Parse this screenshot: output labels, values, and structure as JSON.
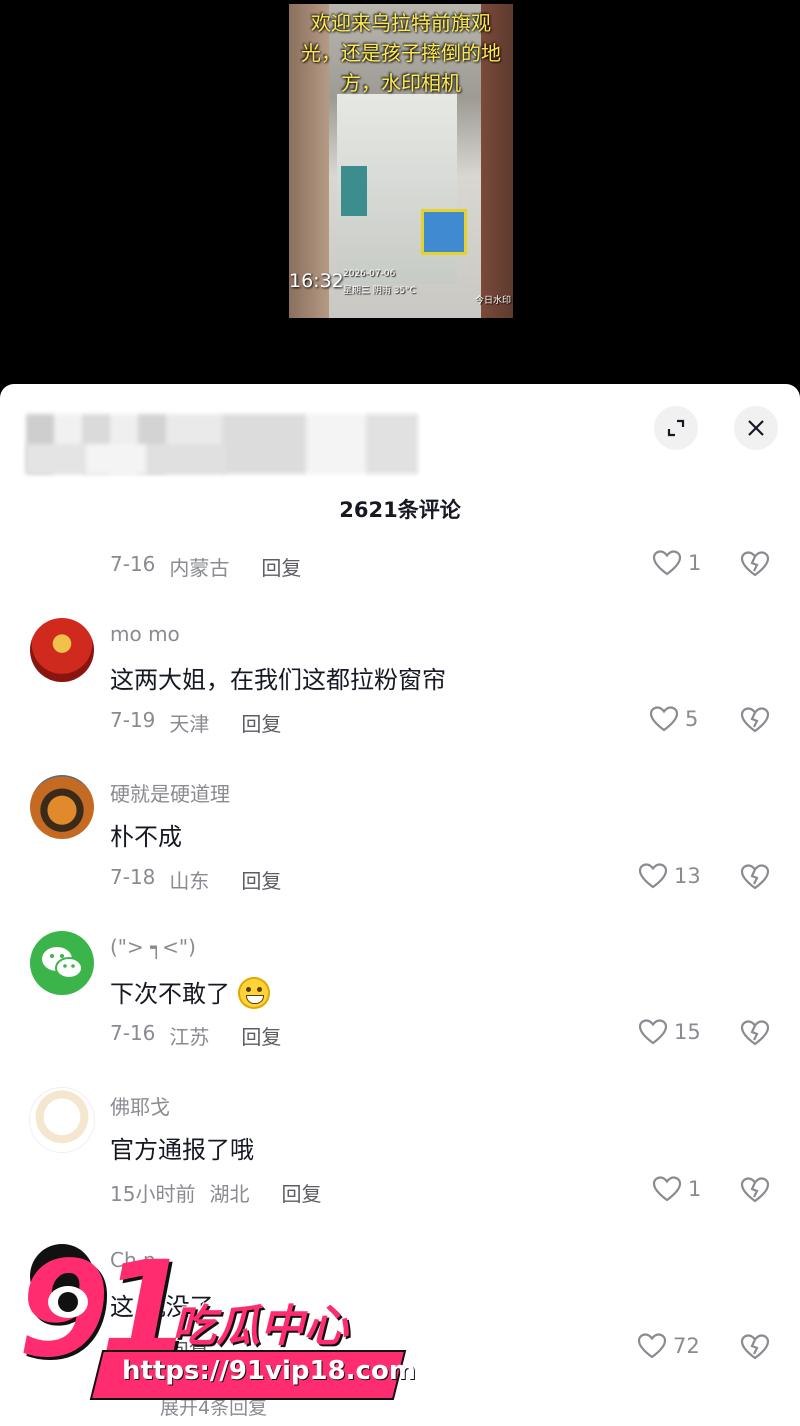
{
  "video": {
    "caption": "欢迎来乌拉特前旗观光，还是孩子摔倒的地方，水印相机",
    "time": "16:32",
    "date": "2026-07-06",
    "meta": "星期三 阴雨 35°C",
    "watermark": "今日水印"
  },
  "sheet": {
    "comment_count": "2621条评论",
    "expand_icon": "expand-icon",
    "close_icon": "close-icon"
  },
  "comments": [
    {
      "name": "",
      "text": "",
      "date": "7-16",
      "location": "内蒙古",
      "reply": "回复",
      "likes": "1"
    },
    {
      "name": "mo  mo",
      "text": "这两大姐，在我们这都拉粉窗帘",
      "date": "7-19",
      "location": "天津",
      "reply": "回复",
      "likes": "5"
    },
    {
      "name": "硬就是硬道理",
      "text": "朴不成",
      "date": "7-18",
      "location": "山东",
      "reply": "回复",
      "likes": "13"
    },
    {
      "name": "(\"> ┑<\")",
      "text": "下次不敢了",
      "date": "7-16",
      "location": "江苏",
      "reply": "回复",
      "likes": "15"
    },
    {
      "name": "佛耶戈",
      "text": "官方通报了哦",
      "date": "15小时前",
      "location": "湖北",
      "reply": "回复",
      "likes": "1"
    },
    {
      "name": "Ch   n",
      "text": "这   沉没了",
      "date": "7",
      "location": "",
      "reply": "回复",
      "likes": "72"
    }
  ],
  "expand_replies": "展开4条回复",
  "promo": {
    "number": "91",
    "title": "吃瓜中心",
    "url": "https://91vip18.com"
  },
  "colors": {
    "accent": "#ff2d6f",
    "text_primary": "#161823",
    "text_secondary": "#8a8b91"
  }
}
